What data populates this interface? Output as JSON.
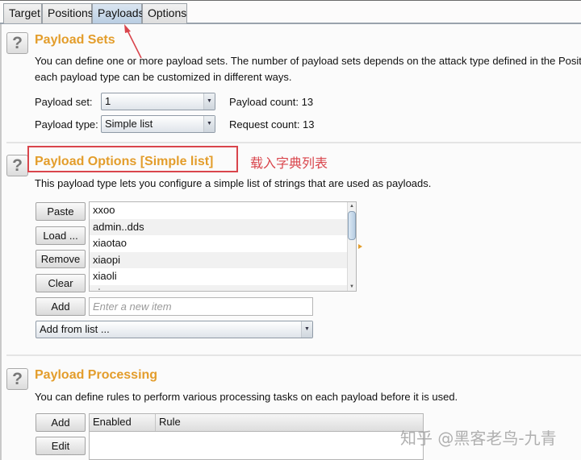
{
  "tabs": [
    {
      "label": "Target",
      "active": false
    },
    {
      "label": "Positions",
      "active": false
    },
    {
      "label": "Payloads",
      "active": true
    },
    {
      "label": "Options",
      "active": false
    }
  ],
  "payload_sets": {
    "help_icon": "?",
    "title": "Payload Sets",
    "description_line1": "You can define one or more payload sets. The number of payload sets depends on the attack type defined in the Positions tab. Various payload types are available for",
    "description_line2": "each payload type can be customized in different ways.",
    "payload_set_label": "Payload set:",
    "payload_set_value": "1",
    "payload_type_label": "Payload type:",
    "payload_type_value": "Simple list",
    "payload_count": "Payload count: 13",
    "request_count": "Request count: 13"
  },
  "payload_options": {
    "help_icon": "?",
    "title": "Payload Options [Simple list]",
    "annotation": "载入字典列表",
    "description": "This payload type lets you configure a simple list of strings that are used as payloads.",
    "buttons": {
      "paste": "Paste",
      "load": "Load ...",
      "remove": "Remove",
      "clear": "Clear",
      "add": "Add"
    },
    "items": [
      "xxoo",
      "admin..dds",
      "xiaotao",
      "xiaopi",
      "xiaoli",
      "xiaoguang"
    ],
    "new_item_placeholder": "Enter a new item",
    "new_item_value": "",
    "add_from_list": "Add from list ..."
  },
  "payload_processing": {
    "help_icon": "?",
    "title": "Payload Processing",
    "description": "You can define rules to perform various processing tasks on each payload before it is used.",
    "buttons": {
      "add": "Add",
      "edit": "Edit"
    },
    "columns": [
      "Enabled",
      "Rule"
    ],
    "rows": []
  },
  "watermark": "知乎 @黑客老鸟-九青",
  "colors": {
    "section_title": "#e39d2b",
    "annotation_red": "#d9454c",
    "active_tab": "#b9cde2"
  }
}
